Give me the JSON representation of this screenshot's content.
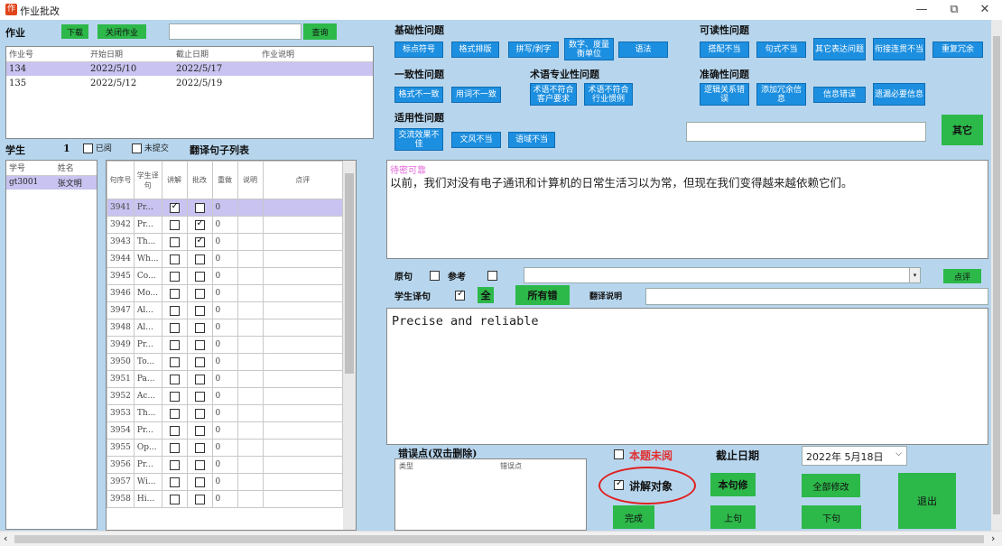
{
  "window": {
    "title": "作业批改",
    "minimize": "—",
    "restore": "⧉",
    "close": "✕"
  },
  "homework": {
    "section_label": "作业",
    "download": "下载",
    "close_btn": "关闭作业",
    "query": "查询",
    "search_value": "",
    "columns": [
      "作业号",
      "开始日期",
      "截止日期",
      "作业说明"
    ],
    "rows": [
      [
        "134",
        "2022/5/10",
        "2022/5/17",
        ""
      ],
      [
        "135",
        "2022/5/12",
        "2022/5/19",
        ""
      ]
    ]
  },
  "students": {
    "label": "学生",
    "count": "1",
    "reviewed": "已阅",
    "unsubmitted": "未提交",
    "columns": [
      "学号",
      "姓名"
    ],
    "rows": [
      [
        "gt3001",
        "张文明"
      ]
    ]
  },
  "sentences": {
    "label": "翻译句子列表",
    "columns": [
      "句序号",
      "学生译句",
      "讲解",
      "批改",
      "重做",
      "说明",
      "点评"
    ],
    "rows": [
      {
        "id": "3941",
        "t": "Pr...",
        "jj": true,
        "pg": false,
        "cz": "0"
      },
      {
        "id": "3942",
        "t": "Pr...",
        "jj": false,
        "pg": true,
        "cz": "0"
      },
      {
        "id": "3943",
        "t": "Th...",
        "jj": false,
        "pg": true,
        "cz": "0"
      },
      {
        "id": "3944",
        "t": "Wh...",
        "jj": false,
        "pg": false,
        "cz": "0"
      },
      {
        "id": "3945",
        "t": "Co...",
        "jj": false,
        "pg": false,
        "cz": "0"
      },
      {
        "id": "3946",
        "t": "Mo...",
        "jj": false,
        "pg": false,
        "cz": "0"
      },
      {
        "id": "3947",
        "t": "Al...",
        "jj": false,
        "pg": false,
        "cz": "0"
      },
      {
        "id": "3948",
        "t": "Al...",
        "jj": false,
        "pg": false,
        "cz": "0"
      },
      {
        "id": "3949",
        "t": "Pr...",
        "jj": false,
        "pg": false,
        "cz": "0"
      },
      {
        "id": "3950",
        "t": "To...",
        "jj": false,
        "pg": false,
        "cz": "0"
      },
      {
        "id": "3951",
        "t": "Pa...",
        "jj": false,
        "pg": false,
        "cz": "0"
      },
      {
        "id": "3952",
        "t": "Ac...",
        "jj": false,
        "pg": false,
        "cz": "0"
      },
      {
        "id": "3953",
        "t": "Th...",
        "jj": false,
        "pg": false,
        "cz": "0"
      },
      {
        "id": "3954",
        "t": "Pr...",
        "jj": false,
        "pg": false,
        "cz": "0"
      },
      {
        "id": "3955",
        "t": "Op...",
        "jj": false,
        "pg": false,
        "cz": "0"
      },
      {
        "id": "3956",
        "t": "Pr...",
        "jj": false,
        "pg": false,
        "cz": "0"
      },
      {
        "id": "3957",
        "t": "Wi...",
        "jj": false,
        "pg": false,
        "cz": "0"
      },
      {
        "id": "3958",
        "t": "Hi...",
        "jj": false,
        "pg": false,
        "cz": "0"
      }
    ]
  },
  "issues": {
    "basic": {
      "label": "基础性问题",
      "buttons": [
        "标点符号",
        "格式排版",
        "拼写/剥字",
        "数字、度量衡单位",
        "语法"
      ]
    },
    "consistency": {
      "label": "一致性问题",
      "buttons": [
        "格式不一致",
        "用词不一致"
      ]
    },
    "terminology": {
      "label": "术语专业性问题",
      "buttons": [
        "术语不符合客户要求",
        "术语不符合行业惯例"
      ]
    },
    "applicability": {
      "label": "适用性问题",
      "buttons": [
        "交流效果不佳",
        "文风不当",
        "语域不当"
      ]
    },
    "readability": {
      "label": "可读性问题",
      "buttons": [
        "搭配不当",
        "句式不当",
        "其它表达问题",
        "衔接连贯不当",
        "重复冗余"
      ]
    },
    "accuracy": {
      "label": "准确性问题",
      "buttons": [
        "逻辑关系错误",
        "添加冗余信息",
        "信息错误",
        "遗漏必要信息"
      ]
    },
    "other_btn": "其它",
    "other_value": ""
  },
  "source": {
    "label": "待密可靠",
    "text": "以前，我们对没有电子通讯和计算机的日常生活习以为常，但现在我们变得越来越依赖它们。"
  },
  "controls": {
    "original": "原句",
    "reference": "参考",
    "comment_btn": "点评",
    "student_trans": "学生译句",
    "all": "全",
    "all_wrong": "所有错",
    "trans_note": "翻译说明",
    "translation_text": "Precise and reliable"
  },
  "errors": {
    "label": "错误点(双击删除)",
    "columns": [
      "类型",
      "错误点"
    ]
  },
  "bottom": {
    "not_reviewed": "本题未阅",
    "explain_target": "讲解对象",
    "deadline_label": "截止日期",
    "deadline_value": "2022年 5月18日",
    "this_fix": "本句修",
    "all_fix": "全部修改",
    "exit": "退出",
    "done": "完成",
    "prev": "上句",
    "next": "下句"
  },
  "colors": {
    "panel_bg": "#b7d6ee",
    "blue_btn": "#1d8fe0",
    "green_btn": "#2db84a",
    "highlight_row": "#c8c3f0",
    "circle": "#e02020"
  }
}
